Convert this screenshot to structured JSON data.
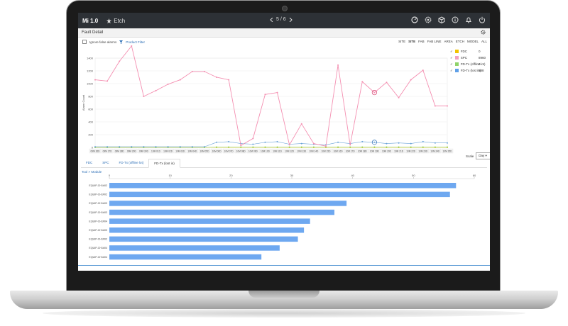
{
  "app": {
    "logo": "Mi 1.0",
    "site_button": "Etch",
    "pager": "5 / 6"
  },
  "page": {
    "title": "Fault Detail"
  },
  "filters": {
    "ignore": "Ignore false alarms",
    "product_filter": "Product Filter"
  },
  "tags": [
    "SITE",
    "SITE",
    "FAB",
    "FAB LINE",
    "AREA",
    "ETCH",
    "MODEL",
    "ALL"
  ],
  "legend": [
    {
      "name": "FDC",
      "value": "0",
      "color": "#f2c200"
    },
    {
      "name": "SPC",
      "value": "8960",
      "color": "#f2a0c0"
    },
    {
      "name": "FD-Tx (offline lot)",
      "value": "0",
      "color": "#8fd36a"
    },
    {
      "name": "FD-Tx (lost in)",
      "value": "588",
      "color": "#5fa0e8"
    }
  ],
  "scale": {
    "label": "Scale",
    "value": "Day"
  },
  "tabs": [
    "FDC",
    "SPC",
    "FD-Tx (offline lot)",
    "FD-Tx (lost in)"
  ],
  "active_tab": 3,
  "crumb": "Tool > Module",
  "chart_data": [
    {
      "type": "line",
      "ylabel": "Alarm Count",
      "ylim": [
        0,
        1400
      ],
      "yticks": [
        0,
        200,
        400,
        600,
        800,
        1000,
        1200,
        1400
      ],
      "categories": [
        "09M 26D",
        "09M 27D",
        "09M 28D",
        "09M 29D",
        "09M 30D",
        "10M 01D",
        "10M 02D",
        "10M 03D",
        "10M 04D",
        "10M 05D",
        "10M 06D",
        "10M 07D",
        "10M 08D",
        "10M 09D",
        "10M 10D",
        "10M 11D",
        "10M 12D",
        "10M 13D",
        "10M 14D",
        "10M 15D",
        "10M 16D",
        "10M 17D",
        "10M 18D",
        "10M 19D",
        "10M 20D",
        "10M 21D",
        "10M 22D",
        "10M 23D",
        "10M 24D",
        "10M 25D"
      ],
      "series": [
        {
          "name": "SPC",
          "color": "#f48fb1",
          "values": [
            1060,
            1040,
            1350,
            1590,
            800,
            890,
            990,
            1060,
            1190,
            1190,
            1100,
            1060,
            30,
            140,
            830,
            860,
            40,
            370,
            60,
            20,
            1290,
            40,
            1030,
            860,
            1020,
            780,
            1060,
            1210,
            650,
            650
          ]
        },
        {
          "name": "FD-Tx (lost in)",
          "color": "#6aa3d8",
          "values": [
            10,
            10,
            10,
            10,
            10,
            10,
            10,
            10,
            10,
            10,
            80,
            90,
            60,
            50,
            80,
            90,
            50,
            60,
            50,
            40,
            80,
            60,
            90,
            80,
            60,
            70,
            60,
            90,
            70,
            70
          ]
        },
        {
          "name": "FD-Tx (offline lot)",
          "color": "#8fd36a",
          "values": [
            0,
            0,
            0,
            0,
            0,
            0,
            0,
            0,
            0,
            0,
            5,
            5,
            5,
            5,
            5,
            5,
            5,
            5,
            5,
            5,
            5,
            5,
            5,
            5,
            5,
            5,
            5,
            5,
            5,
            5
          ]
        },
        {
          "name": "FDC",
          "color": "#f2c200",
          "values": [
            0,
            0,
            0,
            0,
            0,
            0,
            0,
            0,
            0,
            0,
            0,
            0,
            0,
            0,
            0,
            0,
            0,
            0,
            0,
            0,
            0,
            0,
            0,
            0,
            0,
            0,
            0,
            0,
            0,
            0
          ]
        }
      ],
      "highlight_index": 23
    },
    {
      "type": "bar",
      "orientation": "horizontal",
      "xlim": [
        0,
        60
      ],
      "xticks": [
        0,
        10,
        20,
        30,
        40,
        50,
        60
      ],
      "color": "#6ea8f0",
      "categories": [
        "EQUIP-CH1#02",
        "EQUIP-CH1#02",
        "EQUIP-CH1#03",
        "EQUIP-CH1#03",
        "EQUIP-CH1#04",
        "EQUIP-CH1#03",
        "EQUIP-CH1#02",
        "EQUIP-CH1#04",
        "EQUIP-CH1#04"
      ],
      "values": [
        57,
        56,
        39,
        37,
        33,
        32,
        31,
        28,
        25
      ]
    }
  ]
}
